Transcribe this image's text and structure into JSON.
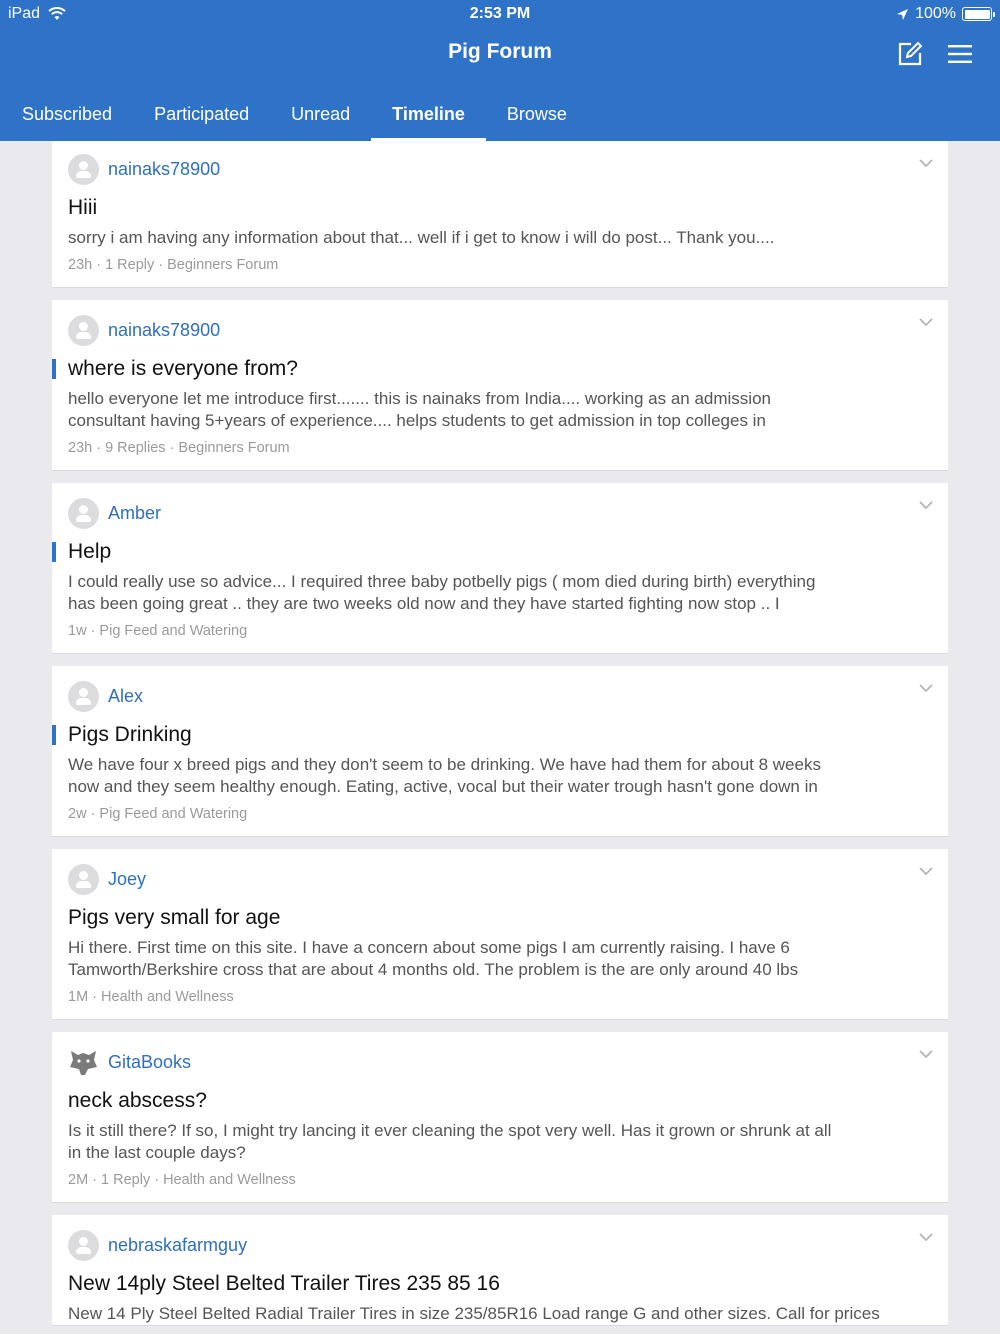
{
  "status_bar": {
    "device": "iPad",
    "time": "2:53 PM",
    "battery": "100%"
  },
  "header": {
    "title": "Pig Forum"
  },
  "tabs": [
    {
      "label": "Subscribed",
      "active": false
    },
    {
      "label": "Participated",
      "active": false
    },
    {
      "label": "Unread",
      "active": false
    },
    {
      "label": "Timeline",
      "active": true
    },
    {
      "label": "Browse",
      "active": false
    }
  ],
  "posts": [
    {
      "author": "nainaks78900",
      "title": "Hiii",
      "snippet": [
        "sorry i am having any information about that... well if i get to know i will do post... Thank you...."
      ],
      "meta": "23h  · 1 Reply  · Beginners Forum",
      "unread": false
    },
    {
      "author": "nainaks78900",
      "title": "where is everyone from?",
      "snippet": [
        "hello everyone let me introduce first....... this is nainaks from India.... working as an admission",
        "consultant having 5+years  of experience.... helps students to get admission in top colleges in"
      ],
      "meta": "23h  · 9 Replies  · Beginners Forum",
      "unread": true
    },
    {
      "author": "Amber",
      "title": "Help",
      "snippet": [
        "I could really use so advice... I required three baby potbelly pigs ( mom died during birth) everything",
        "has been going great .. they are two weeks old now and they have started fighting now stop .. I"
      ],
      "meta": "1w  · Pig Feed and Watering",
      "unread": true
    },
    {
      "author": "Alex",
      "title": "Pigs Drinking",
      "snippet": [
        "We have four x breed pigs and they don't seem to be drinking.  We have had them for about 8 weeks",
        "now and they seem healthy enough.  Eating, active, vocal but their water trough hasn't gone down in"
      ],
      "meta": "2w  · Pig Feed and Watering",
      "unread": true
    },
    {
      "author": "Joey",
      "title": "Pigs very small for age",
      "snippet": [
        "Hi there. First time on this site.  I have a concern about some pigs I am currently raising.  I have 6",
        "Tamworth/Berkshire cross that are about 4 months old. The problem is the are only around 40 lbs"
      ],
      "meta": "1M  · Health and Wellness",
      "unread": false
    },
    {
      "author": "GitaBooks",
      "title": "neck abscess?",
      "snippet": [
        "Is it still there? If so, I might try lancing it ever cleaning the spot very well. Has it grown or shrunk at all",
        "in the last couple days?"
      ],
      "meta": "2M  · 1 Reply  · Health and Wellness",
      "unread": false,
      "avatar": "wolf"
    },
    {
      "author": "nebraskafarmguy",
      "title": "New 14ply Steel Belted Trailer Tires 235 85 16",
      "snippet": [
        "New 14 Ply Steel Belted Radial Trailer Tires in size 235/85R16 Load range G and other sizes. Call for prices"
      ],
      "meta": "",
      "unread": false
    }
  ],
  "colors": {
    "header_bg": "#2f73c8",
    "link": "#2f6fbd",
    "page_bg": "#e9e9ee"
  },
  "icons": {
    "compose": "compose-icon",
    "menu": "hamburger-menu-icon",
    "wifi": "wifi-icon",
    "location": "location-arrow-icon",
    "chevron": "chevron-down-icon"
  }
}
